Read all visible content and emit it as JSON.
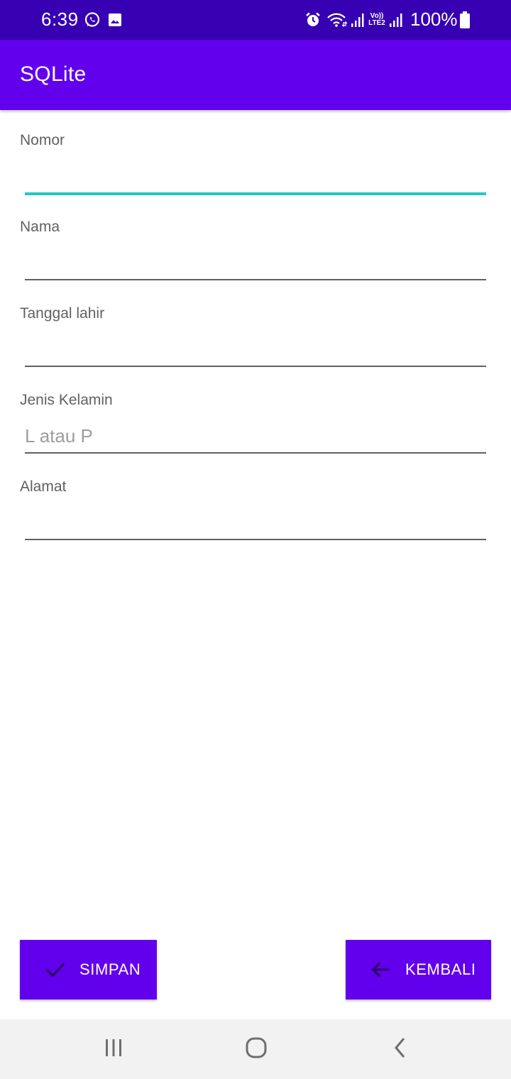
{
  "status_bar": {
    "time": "6:39",
    "battery_percent": "100%",
    "network_label_top": "Vo))",
    "network_label_bottom": "LTE2",
    "icons": [
      "whatsapp-icon",
      "gallery-icon",
      "alarm-icon",
      "wifi-icon",
      "signal-icon",
      "volte-icon",
      "signal-icon",
      "battery-icon"
    ]
  },
  "app_bar": {
    "title": "SQLite",
    "color": "#6200ee"
  },
  "form": {
    "fields": [
      {
        "label": "Nomor",
        "value": "",
        "placeholder": "",
        "focused": true
      },
      {
        "label": "Nama",
        "value": "",
        "placeholder": ""
      },
      {
        "label": "Tanggal lahir",
        "value": "",
        "placeholder": ""
      },
      {
        "label": "Jenis Kelamin",
        "value": "",
        "placeholder": "L atau P"
      },
      {
        "label": "Alamat",
        "value": "",
        "placeholder": ""
      }
    ],
    "focus_color": "#26c6c6"
  },
  "actions": {
    "save_label": "SIMPAN",
    "save_icon": "check-icon",
    "back_label": "KEMBALI",
    "back_icon": "arrow-left-icon"
  },
  "nav_bar": {
    "buttons": [
      "recent-apps-icon",
      "home-icon",
      "back-icon"
    ]
  }
}
